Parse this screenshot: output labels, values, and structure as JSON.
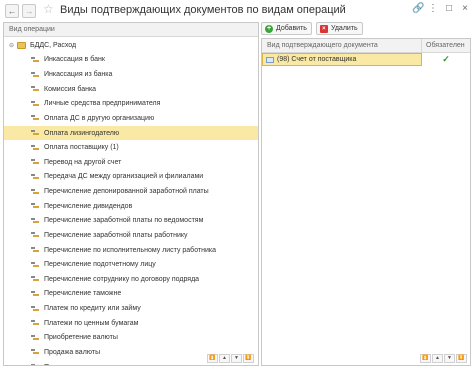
{
  "window": {
    "title": "Виды подтверждающих документов по видам операций",
    "back_icon": "arrow-left-icon",
    "forward_icon": "arrow-right-icon",
    "star_icon": "star-icon",
    "link_icon": "link-icon",
    "menu_icon": "more-vertical-icon",
    "maximize_icon": "maximize-icon",
    "close_icon": "close-icon"
  },
  "left": {
    "column_header": "Вид операции",
    "root": {
      "label": "БДДС, Расход",
      "expanded": true
    },
    "selected_index": 5,
    "items": [
      "Инкассация в банк",
      "Инкассация из банка",
      "Комиссия банка",
      "Личные средства предпринимателя",
      "Оплата ДС в другую организацию",
      "Оплата лизингодателю",
      "Оплата поставщику (1)",
      "Перевод на другой счет",
      "Передача ДС между организацией и филиалами",
      "Перечисление депонированной заработной платы",
      "Перечисление дивидендов",
      "Перечисление заработной платы по ведомостям",
      "Перечисление заработной платы работнику",
      "Перечисление по исполнительному листу работника",
      "Перечисление подотчетному лицу",
      "Перечисление сотруднику по договору подряда",
      "Перечисление таможне",
      "Платеж по кредиту или займу",
      "Платежи по ценным бумагам",
      "Приобретение валюты",
      "Продажа валюты",
      "Прочее списание"
    ]
  },
  "toolbar": {
    "add_label": "Добавить",
    "delete_label": "Удалить"
  },
  "right": {
    "col1_header": "Вид подтверждающего документа",
    "col2_header": "Обязателен",
    "rows": [
      {
        "document": "(98) Счет от поставщика",
        "required": true
      }
    ]
  },
  "pager": [
    "⏫",
    "▲",
    "▼",
    "⏬"
  ],
  "colors": {
    "selection": "#f9e9a4",
    "accent_green": "#3aa33a",
    "accent_red": "#dd3333"
  }
}
